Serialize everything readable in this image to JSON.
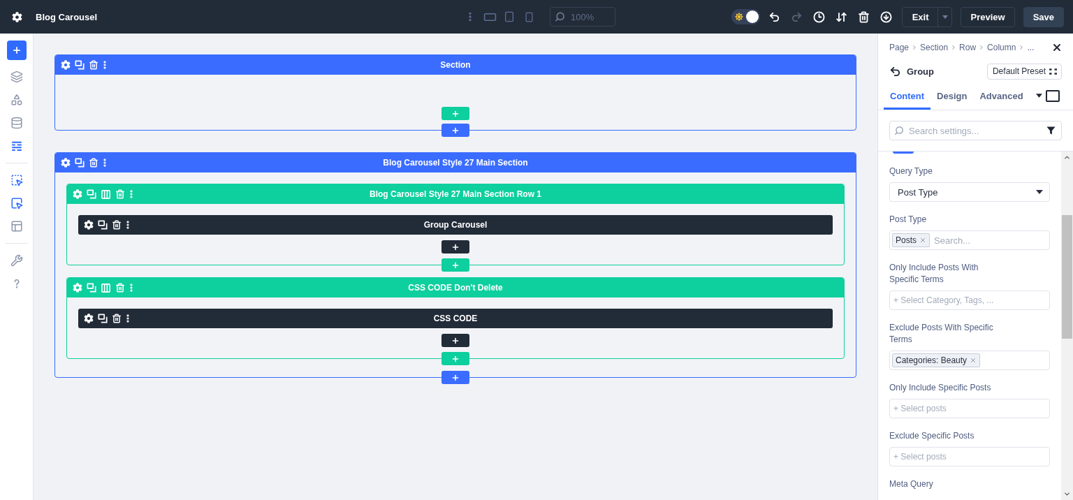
{
  "topbar": {
    "title": "Blog Carousel",
    "zoom": {
      "placeholder": "100%"
    },
    "theme_toggle": {
      "on": true
    },
    "tools": [
      {
        "kind": "undo",
        "disabled": false
      },
      {
        "kind": "redo",
        "disabled": true
      },
      {
        "kind": "history",
        "disabled": false
      },
      {
        "kind": "sort",
        "disabled": false
      },
      {
        "kind": "trash",
        "disabled": false
      },
      {
        "kind": "download",
        "disabled": false
      }
    ],
    "buttons": [
      {
        "kind": "split",
        "label": "Exit"
      },
      {
        "kind": "outline",
        "label": "Preview"
      },
      {
        "kind": "primary",
        "label": "Save"
      }
    ]
  },
  "sidebar": {
    "groups": [
      [
        {
          "kind": "layers",
          "active": false
        },
        {
          "kind": "library",
          "active": false
        },
        {
          "kind": "database",
          "active": false
        },
        {
          "kind": "list",
          "active": true
        }
      ],
      [
        {
          "kind": "select",
          "active": true
        },
        {
          "kind": "multi_select",
          "active": true
        },
        {
          "kind": "layout_preview",
          "active": false
        }
      ],
      [
        {
          "kind": "tools",
          "active": false
        },
        {
          "kind": "help",
          "active": false
        }
      ]
    ]
  },
  "canvas": {
    "sections": [
      {
        "title": "Section"
      },
      {
        "title": "Blog Carousel Style 27 Main Section",
        "rows": [
          {
            "title": "Blog Carousel Style 27 Main Section Row 1",
            "modules": [
              {
                "title": "Group Carousel"
              }
            ]
          },
          {
            "title": "CSS CODE Don't Delete",
            "modules": [
              {
                "title": "CSS CODE"
              }
            ]
          }
        ]
      }
    ]
  },
  "panel": {
    "breadcrumb": [
      "Page",
      "Section",
      "Row",
      "Column",
      "..."
    ],
    "title": "Group",
    "preset": "Default Preset",
    "tabs": [
      {
        "label": "Content",
        "selected": true
      },
      {
        "label": "Design",
        "selected": false
      },
      {
        "label": "Advanced",
        "selected": false
      }
    ],
    "search": {
      "placeholder": "Search settings..."
    },
    "fields": [
      {
        "kind": "select",
        "label": "Query Type",
        "value": "Post Type"
      },
      {
        "kind": "tags",
        "label": "Post Type",
        "tags": [
          "Posts"
        ],
        "placeholder": "Search..."
      },
      {
        "kind": "picker",
        "label": "Only Include Posts With Specific Terms",
        "placeholder": "+ Select Category, Tags, ..."
      },
      {
        "kind": "tags",
        "label": "Exclude Posts With Specific Terms",
        "tags": [
          "Categories: Beauty"
        ]
      },
      {
        "kind": "picker",
        "label": "Only Include Specific Posts",
        "placeholder": "+ Select posts"
      },
      {
        "kind": "picker",
        "label": "Exclude Specific Posts",
        "placeholder": "+ Select posts"
      },
      {
        "kind": "heading",
        "label": "Meta Query"
      }
    ]
  }
}
